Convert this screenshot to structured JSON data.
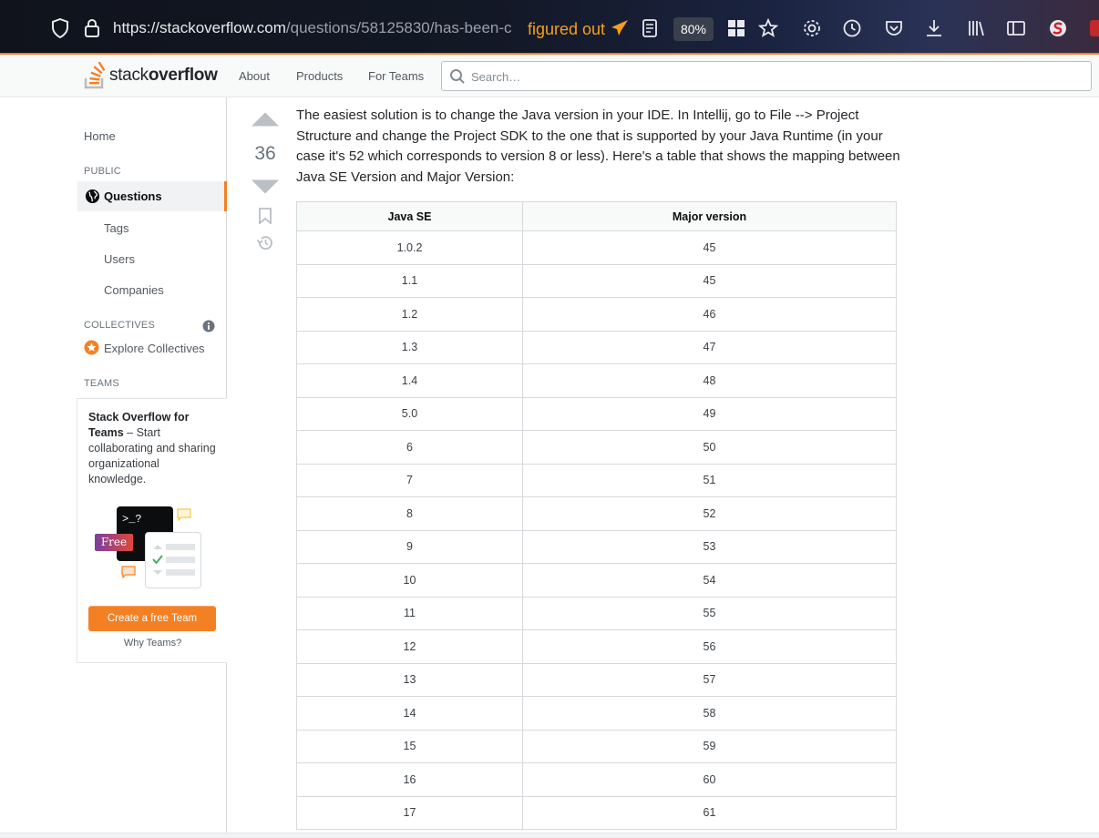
{
  "browser": {
    "url_host": "https://stackoverflow.com",
    "url_path": "/questions/58125830/has-been-c",
    "extension_text": "figured out",
    "zoom": "80%"
  },
  "header": {
    "logo_text_light": "stack",
    "logo_text_bold": "overflow",
    "nav": [
      "About",
      "Products",
      "For Teams"
    ],
    "search_placeholder": "Search…"
  },
  "sidebar": {
    "home": "Home",
    "public_heading": "PUBLIC",
    "questions": "Questions",
    "tags": "Tags",
    "users": "Users",
    "companies": "Companies",
    "collectives_heading": "COLLECTIVES",
    "explore_collectives": "Explore Collectives",
    "teams_heading": "TEAMS",
    "teams_title": "Stack Overflow for Teams",
    "teams_desc": " – Start collaborating and sharing organizational knowledge.",
    "free_badge": "Free",
    "terminal_prompt": ">_?",
    "create_team": "Create a free Team",
    "why_teams": "Why Teams?"
  },
  "answer": {
    "votes": "36",
    "body": "The easiest solution is to change the Java version in your IDE. In Intellij, go to File --> Project Structure and change the Project SDK to the one that is supported by your Java Runtime (in your case it's 52 which corresponds to version 8 or less). Here's a table that shows the mapping between Java SE Version and Major Version:",
    "table": {
      "headers": [
        "Java SE",
        "Major version"
      ],
      "rows": [
        [
          "1.0.2",
          "45"
        ],
        [
          "1.1",
          "45"
        ],
        [
          "1.2",
          "46"
        ],
        [
          "1.3",
          "47"
        ],
        [
          "1.4",
          "48"
        ],
        [
          "5.0",
          "49"
        ],
        [
          "6",
          "50"
        ],
        [
          "7",
          "51"
        ],
        [
          "8",
          "52"
        ],
        [
          "9",
          "53"
        ],
        [
          "10",
          "54"
        ],
        [
          "11",
          "55"
        ],
        [
          "12",
          "56"
        ],
        [
          "13",
          "57"
        ],
        [
          "14",
          "58"
        ],
        [
          "15",
          "59"
        ],
        [
          "16",
          "60"
        ],
        [
          "17",
          "61"
        ]
      ]
    }
  },
  "colors": {
    "accent": "#f48024",
    "extension": "#f4a01e"
  }
}
